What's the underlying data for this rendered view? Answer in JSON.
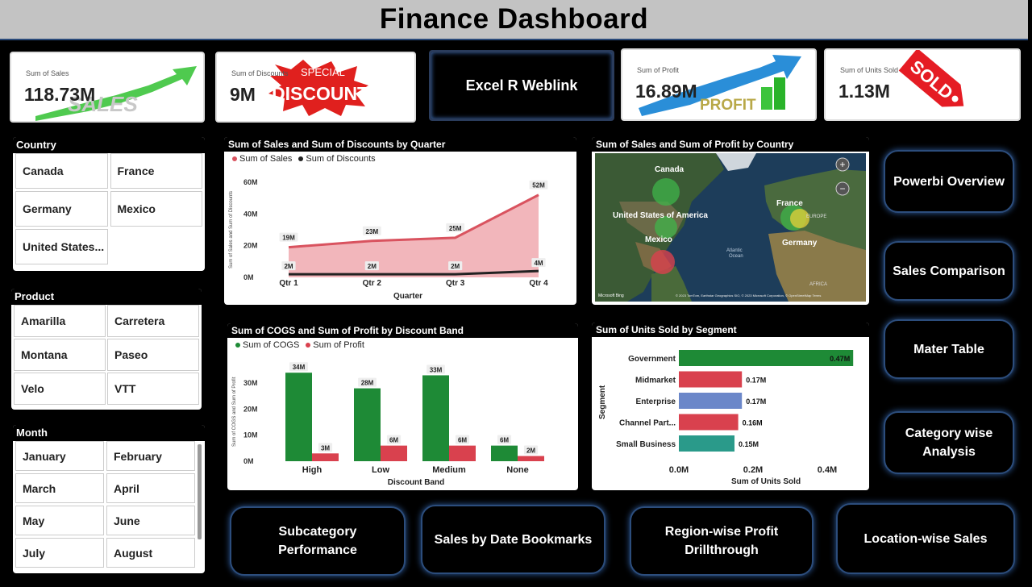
{
  "title": "Finance Dashboard",
  "kpis": {
    "sales": {
      "label": "Sum of Sales",
      "value": "118.73M",
      "art": "SALES"
    },
    "discount": {
      "label": "Sum of Discounts",
      "value": "9M",
      "art_top": "SPECIAL",
      "art": "DISCOUNT"
    },
    "weblink": "Excel R Weblink",
    "profit": {
      "label": "Sum of Profit",
      "value": "16.89M",
      "art": "PROFIT"
    },
    "units": {
      "label": "Sum of Units Sold",
      "value": "1.13M",
      "art": "SOLD"
    }
  },
  "slicers": {
    "country": {
      "title": "Country",
      "items": [
        "Canada",
        "France",
        "Germany",
        "Mexico",
        "United States..."
      ]
    },
    "product": {
      "title": "Product",
      "items": [
        "Amarilla",
        "Carretera",
        "Montana",
        "Paseo",
        "Velo",
        "VTT"
      ]
    },
    "month": {
      "title": "Month",
      "items": [
        "January",
        "February",
        "March",
        "April",
        "May",
        "June",
        "July",
        "August"
      ]
    }
  },
  "charts": {
    "quarter": {
      "title": "Sum of Sales and Sum of Discounts by Quarter",
      "legend": [
        "Sum of Sales",
        "Sum of Discounts"
      ],
      "xlabel": "Quarter",
      "ylabel": "Sum of Sales and Sum of Discounts",
      "yticks": [
        "60M",
        "40M",
        "20M",
        "0M"
      ]
    },
    "map": {
      "title": "Sum of Sales and Sum of Profit by Country",
      "labels": {
        "canada": "Canada",
        "usa": "United States of America",
        "mexico": "Mexico",
        "france": "France",
        "germany": "Germany",
        "europe": "EUROPE",
        "africa": "AFRICA",
        "atlantic1": "Atlantic",
        "atlantic2": "Ocean"
      },
      "footer_left": "Microsoft Bing",
      "footer_right": "© 2023 TomTom, Earthstar Geographics SIO, © 2023 Microsoft Corporation, © OpenStreetMap  Terms",
      "zoom_in": "+",
      "zoom_out": "−"
    },
    "cogs": {
      "title": "Sum of COGS and Sum of Profit by Discount Band",
      "legend": [
        "Sum of COGS",
        "Sum of Profit"
      ],
      "xlabel": "Discount Band",
      "ylabel": "Sum of COGS and Sum of Profit",
      "yticks": [
        "30M",
        "20M",
        "10M",
        "0M"
      ]
    },
    "segment": {
      "title": "Sum of Units Sold by Segment",
      "xlabel": "Sum of Units Sold",
      "ylabel": "Segment",
      "xticks": [
        "0.0M",
        "0.2M",
        "0.4M"
      ]
    }
  },
  "nav": {
    "powerbi": "Powerbi Overview",
    "sales_comparison": "Sales Comparison",
    "mater_table": "Mater Table",
    "category": "Category wise Analysis",
    "subcategory": "Subcategory Performance",
    "sales_date": "Sales by Date Bookmarks",
    "region": "Region-wise Profit Drillthrough",
    "location": "Location-wise Sales"
  },
  "colors": {
    "sales": "#d9535f",
    "discounts": "#222222",
    "cogs": "#1e8a36",
    "profit": "#d9414e",
    "enterprise": "#6b87c9",
    "small_business": "#2a9a8a"
  },
  "chart_data": [
    {
      "type": "area",
      "title": "Sum of Sales and Sum of Discounts by Quarter",
      "categories": [
        "Qtr 1",
        "Qtr 2",
        "Qtr 3",
        "Qtr 4"
      ],
      "series": [
        {
          "name": "Sum of Sales",
          "values": [
            19,
            23,
            25,
            52
          ],
          "labels": [
            "19M",
            "23M",
            "25M",
            "52M"
          ]
        },
        {
          "name": "Sum of Discounts",
          "values": [
            2,
            2,
            2,
            4
          ],
          "labels": [
            "2M",
            "2M",
            "2M",
            "4M"
          ]
        }
      ],
      "xlabel": "Quarter",
      "ylabel": "Sum of Sales and Sum of Discounts",
      "ylim": [
        0,
        60
      ]
    },
    {
      "type": "bar",
      "title": "Sum of COGS and Sum of Profit by Discount Band",
      "categories": [
        "High",
        "Low",
        "Medium",
        "None"
      ],
      "series": [
        {
          "name": "Sum of COGS",
          "values": [
            34,
            28,
            33,
            6
          ],
          "labels": [
            "34M",
            "28M",
            "33M",
            "6M"
          ]
        },
        {
          "name": "Sum of Profit",
          "values": [
            3,
            6,
            6,
            2
          ],
          "labels": [
            "3M",
            "6M",
            "6M",
            "2M"
          ]
        }
      ],
      "xlabel": "Discount Band",
      "ylabel": "Sum of COGS and Sum of Profit",
      "ylim": [
        0,
        35
      ]
    },
    {
      "type": "bar",
      "orientation": "horizontal",
      "title": "Sum of Units Sold by Segment",
      "categories": [
        "Government",
        "Midmarket",
        "Enterprise",
        "Channel Part...",
        "Small Business"
      ],
      "values": [
        0.47,
        0.17,
        0.17,
        0.16,
        0.15
      ],
      "labels": [
        "0.47M",
        "0.17M",
        "0.17M",
        "0.16M",
        "0.15M"
      ],
      "xlabel": "Sum of Units Sold",
      "ylabel": "Segment",
      "xlim": [
        0,
        0.5
      ]
    }
  ]
}
